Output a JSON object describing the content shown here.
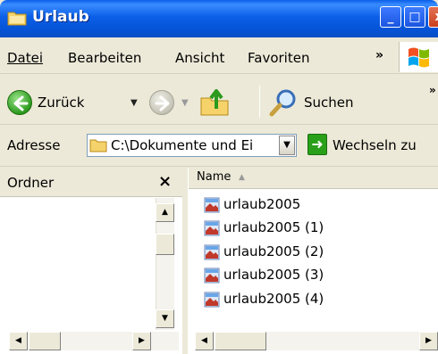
{
  "window": {
    "title": "Urlaub",
    "controls": {
      "minimize": "_",
      "maximize": "□",
      "close": "x"
    }
  },
  "menu": {
    "items": [
      {
        "label": "Datei",
        "accel": "D"
      },
      {
        "label": "Bearbeiten",
        "accel": "B"
      },
      {
        "label": "Ansicht",
        "accel": "A"
      },
      {
        "label": "Favoriten",
        "accel": "F"
      }
    ],
    "more": "»"
  },
  "toolbar": {
    "back_label": "Zurück",
    "search_label": "Suchen",
    "more": "»"
  },
  "address": {
    "label": "Adresse",
    "value": "C:\\Dokumente und Ei",
    "go_label": "Wechseln zu"
  },
  "folders_pane": {
    "title": "Ordner",
    "close": "×"
  },
  "files": {
    "column_name": "Name",
    "items": [
      "urlaub2005",
      "urlaub2005 (1)",
      "urlaub2005 (2)",
      "urlaub2005 (3)",
      "urlaub2005 (4)"
    ]
  },
  "colors": {
    "titlebar": "#0553d6",
    "chrome": "#ece9d8",
    "close_button": "#c9401e"
  }
}
